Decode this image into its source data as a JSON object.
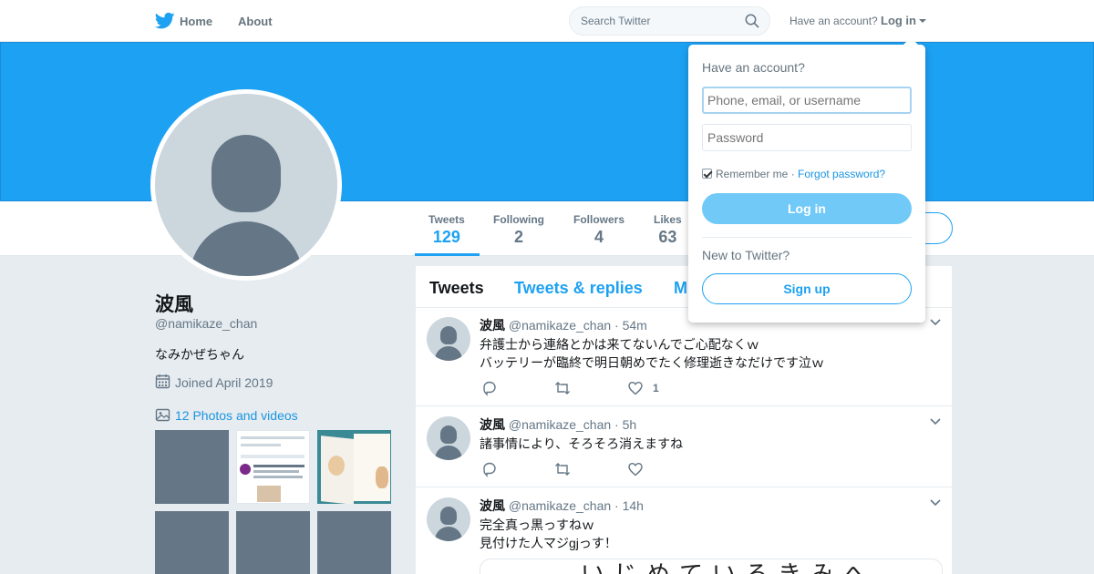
{
  "nav": {
    "home_label": "Home",
    "about_label": "About",
    "search_placeholder": "Search Twitter",
    "have_account": "Have an account?",
    "login_label": "Log in"
  },
  "colors": {
    "brand": "#1da1f2",
    "banner": "#1da1f2",
    "background": "#e6ecf0"
  },
  "profile": {
    "display_name": "波風",
    "handle": "@namikaze_chan",
    "bio": "なみかぜちゃん",
    "joined": "Joined April 2019",
    "photos_link": "12 Photos and videos"
  },
  "stats": [
    {
      "label": "Tweets",
      "value": "129"
    },
    {
      "label": "Following",
      "value": "2"
    },
    {
      "label": "Followers",
      "value": "4"
    },
    {
      "label": "Likes",
      "value": "63"
    }
  ],
  "timeline": {
    "tabs": [
      "Tweets",
      "Tweets & replies",
      "M"
    ],
    "tweets": [
      {
        "name": "波風",
        "meta": "@namikaze_chan · 54m",
        "lines": [
          "弁護士から連絡とかは来てないんでご心配なくｗ",
          "バッテリーが臨終で明日朝めでたく修理逝きなだけです泣ｗ"
        ],
        "like_count": "1"
      },
      {
        "name": "波風",
        "meta": "@namikaze_chan · 5h",
        "lines": [
          "諸事情により、そろそろ消えますね"
        ],
        "like_count": ""
      },
      {
        "name": "波風",
        "meta": "@namikaze_chan · 14h",
        "lines": [
          "完全真っ黒っすねｗ",
          "見付けた人マジgjっす！"
        ],
        "media_text": "いじめているきみへ"
      }
    ]
  },
  "login_dropdown": {
    "title": "Have an account?",
    "username_placeholder": "Phone, email, or username",
    "password_placeholder": "Password",
    "remember_label": "Remember me",
    "separator": " · ",
    "forgot_label": "Forgot password?",
    "login_button": "Log in",
    "new_label": "New to Twitter?",
    "signup_button": "Sign up"
  }
}
